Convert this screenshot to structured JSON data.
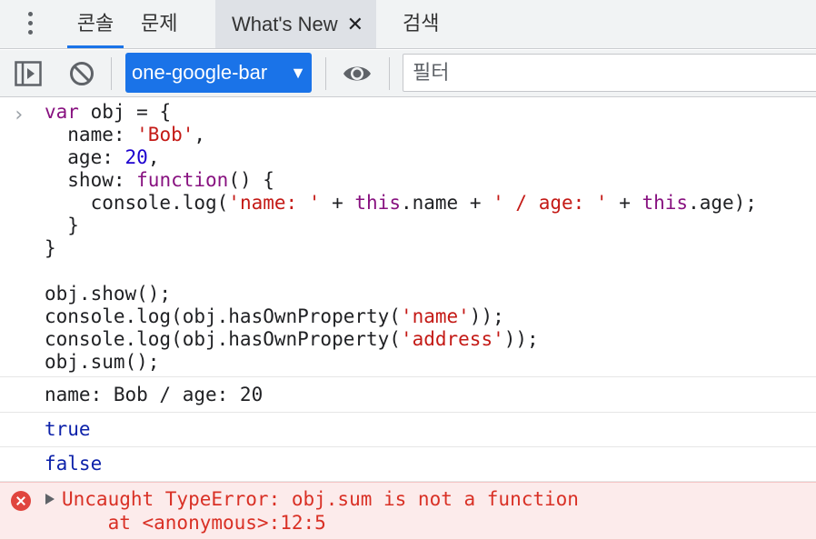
{
  "tabs": [
    {
      "label": "콘솔",
      "active": true
    },
    {
      "label": "문제",
      "active": false
    },
    {
      "label": "What's New",
      "active": false,
      "close": "✕"
    },
    {
      "label": "검색",
      "active": false
    }
  ],
  "toolbar": {
    "context": "one-google-bar",
    "context_caret": "▼",
    "filter_placeholder": "필터"
  },
  "console_input": {
    "prompt": "›",
    "lines": [
      [
        {
          "t": "var",
          "c": "kw"
        },
        {
          "t": " obj = {"
        }
      ],
      [
        {
          "t": "  name: "
        },
        {
          "t": "'Bob'",
          "c": "str"
        },
        {
          "t": ","
        }
      ],
      [
        {
          "t": "  age: "
        },
        {
          "t": "20",
          "c": "num"
        },
        {
          "t": ","
        }
      ],
      [
        {
          "t": "  show: "
        },
        {
          "t": "function",
          "c": "kw"
        },
        {
          "t": "() {"
        }
      ],
      [
        {
          "t": "    console.log("
        },
        {
          "t": "'name: '",
          "c": "str"
        },
        {
          "t": " + "
        },
        {
          "t": "this",
          "c": "kw"
        },
        {
          "t": ".name + "
        },
        {
          "t": "' / age: '",
          "c": "str"
        },
        {
          "t": " + "
        },
        {
          "t": "this",
          "c": "kw"
        },
        {
          "t": ".age);"
        }
      ],
      [
        {
          "t": "  }"
        }
      ],
      [
        {
          "t": "}"
        }
      ],
      [
        {
          "t": ""
        }
      ],
      [
        {
          "t": "obj.show();"
        }
      ],
      [
        {
          "t": "console.log(obj.hasOwnProperty("
        },
        {
          "t": "'name'",
          "c": "str"
        },
        {
          "t": "));"
        }
      ],
      [
        {
          "t": "console.log(obj.hasOwnProperty("
        },
        {
          "t": "'address'",
          "c": "str"
        },
        {
          "t": "));"
        }
      ],
      [
        {
          "t": "obj.sum();"
        }
      ]
    ]
  },
  "outputs": {
    "log1": "name: Bob / age: 20",
    "log2": "true",
    "log3": "false"
  },
  "error": {
    "message": "Uncaught TypeError: obj.sum is not a function",
    "stack": "    at <anonymous>:12:5"
  },
  "colors": {
    "accent": "#1a73e8",
    "keyword": "#881280",
    "string": "#c41a16",
    "number": "#1c00cf",
    "error": "#d93025"
  }
}
